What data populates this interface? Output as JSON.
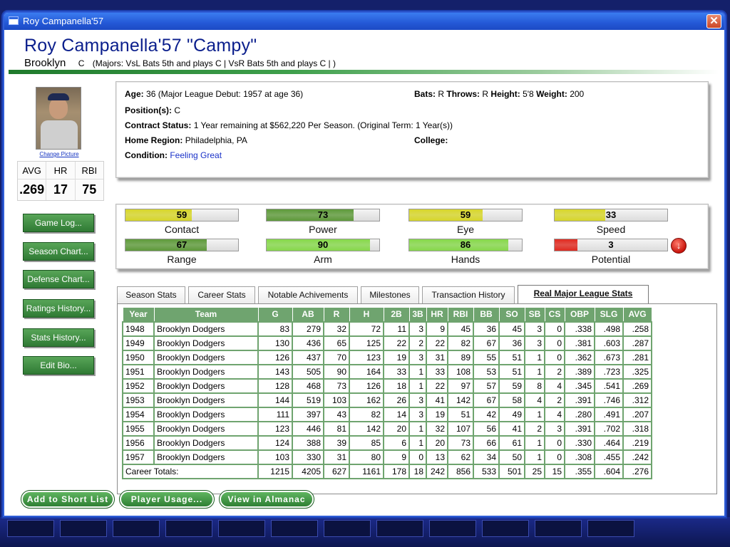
{
  "window": {
    "title": "Roy Campanella'57",
    "close_glyph": "✕"
  },
  "player": {
    "name": "Roy Campanella'57  \"Campy\"",
    "team": "Brooklyn",
    "position": "C",
    "lineup_note": "(Majors: VsL Bats 5th and plays C  | VsR Bats 5th and plays C  | )"
  },
  "photo": {
    "change_label": "Change Picture"
  },
  "summary": {
    "headers": [
      "AVG",
      "HR",
      "RBI"
    ],
    "values": [
      ".269",
      "17",
      "75"
    ]
  },
  "side_buttons": [
    "Game Log...",
    "Season Chart...",
    "Defense Chart...",
    "Ratings History...",
    "Stats History...",
    "Edit Bio..."
  ],
  "info": {
    "age_label": "Age:",
    "age_value": "36  (Major League Debut: 1957 at age 36)",
    "bats_label": "Bats:",
    "bats_value": "R",
    "throws_label": "Throws:",
    "throws_value": "R",
    "height_label": "Height:",
    "height_value": "5'8",
    "weight_label": "Weight:",
    "weight_value": "200",
    "positions_label": "Position(s):",
    "positions_value": "C",
    "contract_label": "Contract Status:",
    "contract_value": "1 Year remaining at $562,220 Per Season. (Original Term: 1 Year(s))",
    "region_label": "Home Region:",
    "region_value": "Philadelphia, PA",
    "college_label": "College:",
    "college_value": "",
    "condition_label": "Condition:",
    "condition_value": "Feeling Great"
  },
  "ratings": [
    {
      "label": "Contact",
      "value": "59",
      "fraction": 0.59,
      "color": "#d7d62a"
    },
    {
      "label": "Power",
      "value": "73",
      "fraction": 0.77,
      "color": "#5e9a3a"
    },
    {
      "label": "Eye",
      "value": "59",
      "fraction": 0.65,
      "color": "#d7d62a"
    },
    {
      "label": "Speed",
      "value": "33",
      "fraction": 0.45,
      "color": "#d7d62a"
    },
    {
      "label": "Range",
      "value": "67",
      "fraction": 0.72,
      "color": "#5e9a3a"
    },
    {
      "label": "Arm",
      "value": "90",
      "fraction": 0.92,
      "color": "#86d84a"
    },
    {
      "label": "Hands",
      "value": "86",
      "fraction": 0.88,
      "color": "#86d84a"
    },
    {
      "label": "Potential",
      "value": "3",
      "fraction": 0.2,
      "color": "#e02a20"
    }
  ],
  "potential_icon": "down-arrow-icon",
  "potential_glyph": "↓",
  "tabs": [
    "Season Stats",
    "Career Stats",
    "Notable Achivements",
    "Milestones",
    "Transaction History",
    "Real Major League Stats"
  ],
  "active_tab": 5,
  "stats_table": {
    "headers": [
      "Year",
      "Team",
      "G",
      "AB",
      "R",
      "H",
      "2B",
      "3B",
      "HR",
      "RBI",
      "BB",
      "SO",
      "SB",
      "CS",
      "OBP",
      "SLG",
      "AVG"
    ],
    "rows": [
      [
        "1948",
        "Brooklyn Dodgers",
        "83",
        "279",
        "32",
        "72",
        "11",
        "3",
        "9",
        "45",
        "36",
        "45",
        "3",
        "0",
        ".338",
        ".498",
        ".258"
      ],
      [
        "1949",
        "Brooklyn Dodgers",
        "130",
        "436",
        "65",
        "125",
        "22",
        "2",
        "22",
        "82",
        "67",
        "36",
        "3",
        "0",
        ".381",
        ".603",
        ".287"
      ],
      [
        "1950",
        "Brooklyn Dodgers",
        "126",
        "437",
        "70",
        "123",
        "19",
        "3",
        "31",
        "89",
        "55",
        "51",
        "1",
        "0",
        ".362",
        ".673",
        ".281"
      ],
      [
        "1951",
        "Brooklyn Dodgers",
        "143",
        "505",
        "90",
        "164",
        "33",
        "1",
        "33",
        "108",
        "53",
        "51",
        "1",
        "2",
        ".389",
        ".723",
        ".325"
      ],
      [
        "1952",
        "Brooklyn Dodgers",
        "128",
        "468",
        "73",
        "126",
        "18",
        "1",
        "22",
        "97",
        "57",
        "59",
        "8",
        "4",
        ".345",
        ".541",
        ".269"
      ],
      [
        "1953",
        "Brooklyn Dodgers",
        "144",
        "519",
        "103",
        "162",
        "26",
        "3",
        "41",
        "142",
        "67",
        "58",
        "4",
        "2",
        ".391",
        ".746",
        ".312"
      ],
      [
        "1954",
        "Brooklyn Dodgers",
        "111",
        "397",
        "43",
        "82",
        "14",
        "3",
        "19",
        "51",
        "42",
        "49",
        "1",
        "4",
        ".280",
        ".491",
        ".207"
      ],
      [
        "1955",
        "Brooklyn Dodgers",
        "123",
        "446",
        "81",
        "142",
        "20",
        "1",
        "32",
        "107",
        "56",
        "41",
        "2",
        "3",
        ".391",
        ".702",
        ".318"
      ],
      [
        "1956",
        "Brooklyn Dodgers",
        "124",
        "388",
        "39",
        "85",
        "6",
        "1",
        "20",
        "73",
        "66",
        "61",
        "1",
        "0",
        ".330",
        ".464",
        ".219"
      ],
      [
        "1957",
        "Brooklyn Dodgers",
        "103",
        "330",
        "31",
        "80",
        "9",
        "0",
        "13",
        "62",
        "34",
        "50",
        "1",
        "0",
        ".308",
        ".455",
        ".242"
      ]
    ],
    "totals_label": "Career Totals:",
    "totals": [
      "1215",
      "4205",
      "627",
      "1161",
      "178",
      "18",
      "242",
      "856",
      "533",
      "501",
      "25",
      "15",
      ".355",
      ".604",
      ".276"
    ]
  },
  "bottom_buttons": [
    "Add to Short List",
    "Player Usage...",
    "View in Almanac"
  ]
}
